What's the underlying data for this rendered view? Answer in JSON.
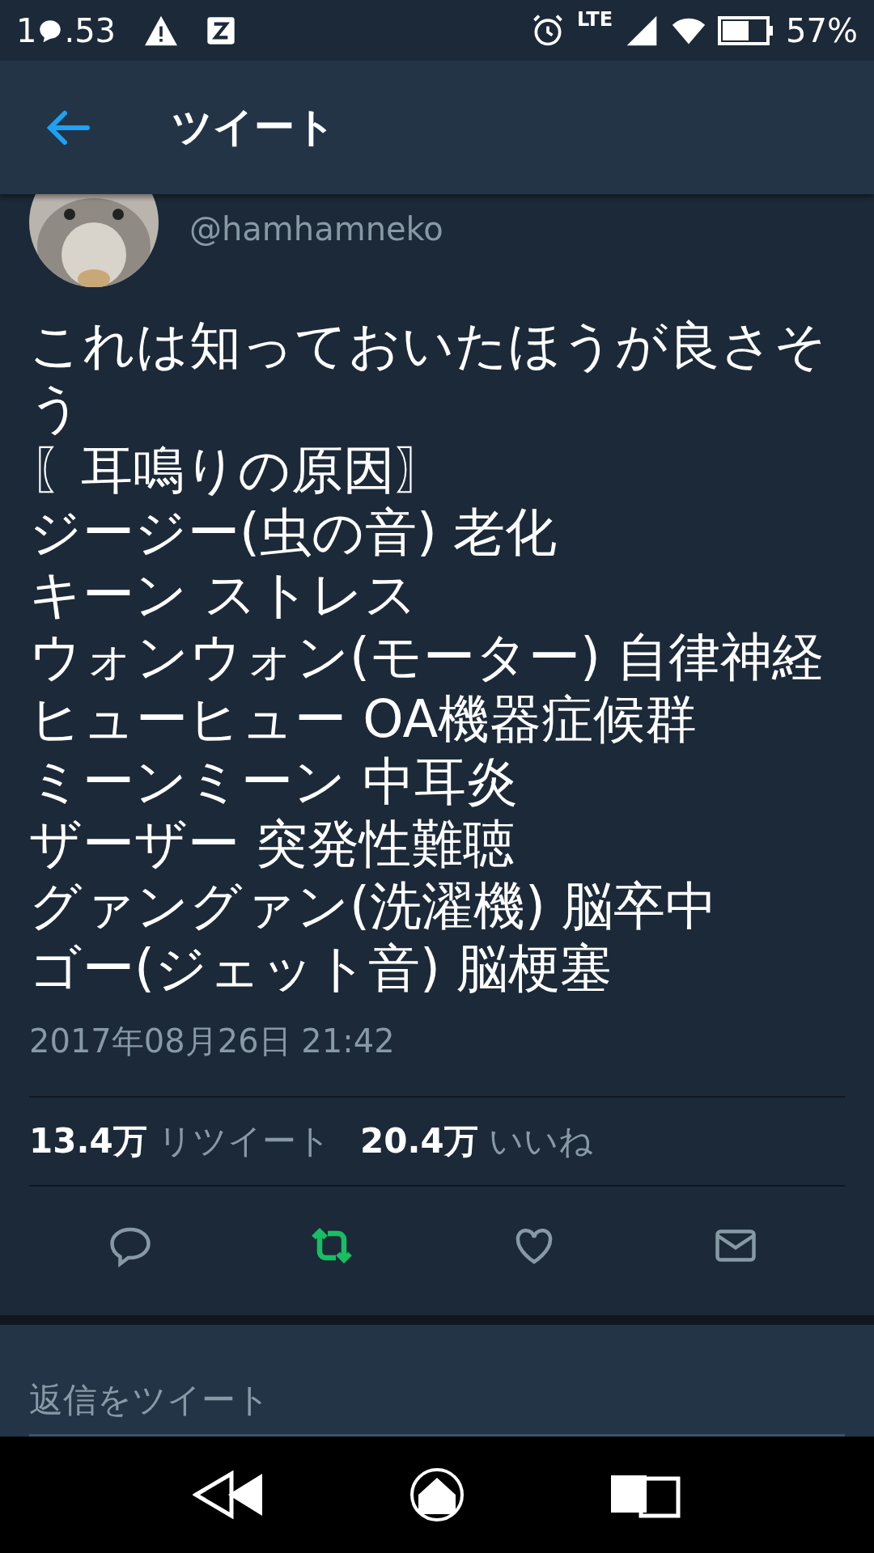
{
  "status_bar": {
    "clock_start": "1",
    "clock_end": ".53",
    "network": "LTE",
    "battery": "57%"
  },
  "header": {
    "title": "ツイート"
  },
  "tweet": {
    "handle": "@hamhamneko",
    "lines": [
      "これは知っておいたほうが良さそう",
      "〖耳鳴りの原因〗",
      "ジージー(虫の音) 老化",
      "キーン ストレス",
      "ウォンウォン(モーター) 自律神経",
      "ヒューヒュー OA機器症候群",
      "ミーンミーン 中耳炎",
      "ザーザー 突発性難聴",
      "グァングァン(洗濯機) 脳卒中",
      "ゴー(ジェット音) 脳梗塞"
    ],
    "timestamp": "2017年08月26日 21:42",
    "stats": [
      {
        "count": "13.4万",
        "label": "リツイート"
      },
      {
        "count": "20.4万",
        "label": "いいね"
      }
    ],
    "actions": [
      {
        "kind": "reply",
        "on": false
      },
      {
        "kind": "retweet",
        "on": true
      },
      {
        "kind": "like",
        "on": false
      },
      {
        "kind": "message",
        "on": false
      }
    ]
  },
  "reply_box": {
    "placeholder": "返信をツイート"
  }
}
